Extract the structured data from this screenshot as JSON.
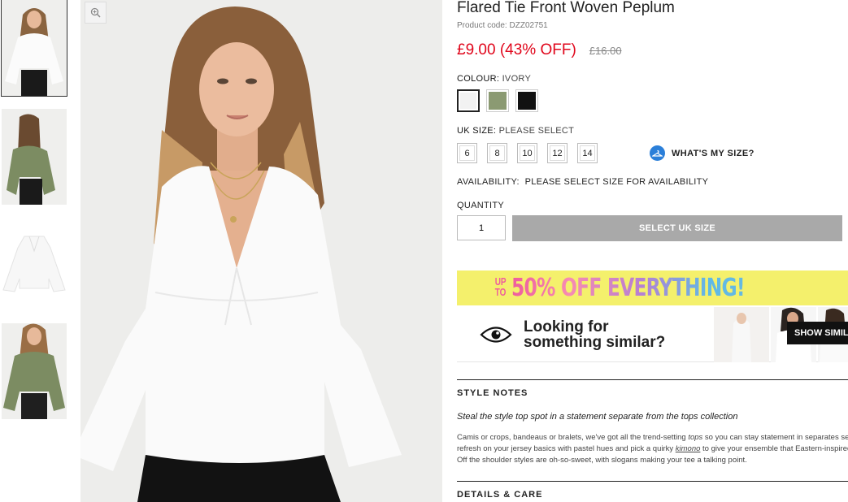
{
  "product": {
    "title": "Flared Tie Front Woven Peplum",
    "code_label": "Product code:",
    "code": "DZZ02751",
    "price": "£9.00 (43% OFF)",
    "was_price": "£16.00"
  },
  "colour": {
    "label": "COLOUR:",
    "value": "IVORY",
    "options": [
      {
        "name": "ivory",
        "hex": "#f2f2f2"
      },
      {
        "name": "khaki",
        "hex": "#8b9a72"
      },
      {
        "name": "black",
        "hex": "#111111"
      }
    ]
  },
  "size": {
    "label": "UK SIZE:",
    "value": "PLEASE SELECT",
    "options": [
      "6",
      "8",
      "10",
      "12",
      "14"
    ],
    "help": "WHAT'S MY SIZE?"
  },
  "availability": {
    "label": "AVAILABILITY:",
    "value": "PLEASE SELECT SIZE FOR AVAILABILITY"
  },
  "quantity": {
    "label": "QUANTITY",
    "value": "1",
    "button": "SELECT UK SIZE"
  },
  "promo": {
    "upto_1": "UP",
    "upto_2": "TO",
    "text": "50% OFF EVERYTHING!"
  },
  "similar": {
    "line1": "Looking for",
    "line2": "something similar?",
    "button": "SHOW SIMILAR"
  },
  "style_notes": {
    "heading": "STYLE NOTES",
    "tagline": "Steal the style top spot in a statement separate from the tops collection",
    "body_1": "Camis or crops, bandeaus or bralets, we've got all the trend-setting ",
    "body_link_1": "tops",
    "body_2": " so you can stay statement in separates season. Hit refresh on your jersey basics with pastel hues and pick a quirky ",
    "body_link_2": "kimono",
    "body_3": " to give your ensemble that Eastern-inspired edge. Off the shoulder styles are oh-so-sweet, with slogans making your tee a talking point."
  },
  "details_care": {
    "heading": "DETAILS & CARE"
  },
  "colors": {
    "sale": "#e0061b",
    "cta_disabled": "#a9a9a9",
    "promo_bg": "#f4f06c",
    "help_icon": "#2b7fd9"
  }
}
